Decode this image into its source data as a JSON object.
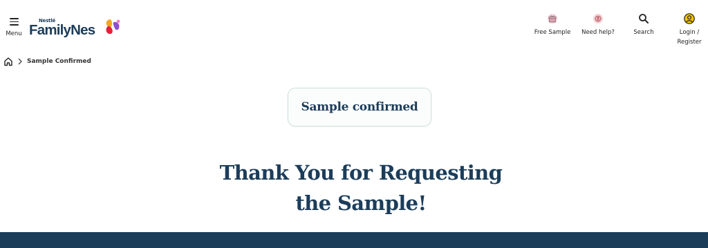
{
  "header": {
    "menu_label": "Menu",
    "logo": {
      "brand_small": "Nestlé",
      "brand_main": "FamilyNes"
    },
    "nav": {
      "free_sample": "Free Sample",
      "need_help": "Need help?",
      "search": "Search",
      "login_line1": "Login /",
      "login_line2": "Register"
    }
  },
  "breadcrumb": {
    "current": "Sample Confirmed"
  },
  "main": {
    "pill_label": "Sample confirmed",
    "thanks_line1": "Thank You for Requesting",
    "thanks_line2": "the Sample!"
  },
  "colors": {
    "brand_navy": "#1c3d5a",
    "pill_border": "#cde1dc",
    "login_icon_fill": "#f2c300",
    "logo_mark": [
      "#f5a623",
      "#e5213a",
      "#8e4fd0"
    ]
  },
  "icons": [
    "hamburger-icon",
    "gift-box-icon",
    "help-icon",
    "search-icon",
    "user-icon",
    "home-icon",
    "chevron-right-icon"
  ]
}
